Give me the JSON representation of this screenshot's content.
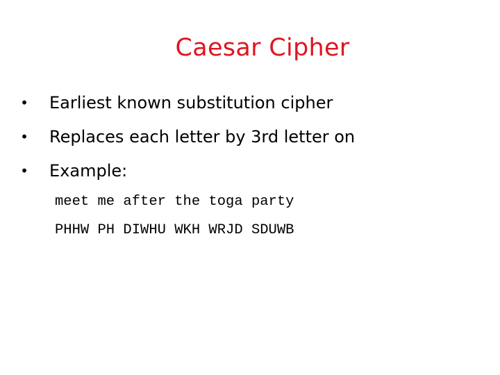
{
  "slide": {
    "title": "Caesar Cipher",
    "title_color": "#e0141e",
    "bullet_glyph": "•",
    "bullets": [
      "Earliest known substitution cipher",
      "Replaces each letter by 3rd letter on",
      "Example:"
    ],
    "example": {
      "plaintext": "meet me after the toga party",
      "ciphertext": "PHHW PH DIWHU WKH WRJD SDUWB"
    }
  }
}
